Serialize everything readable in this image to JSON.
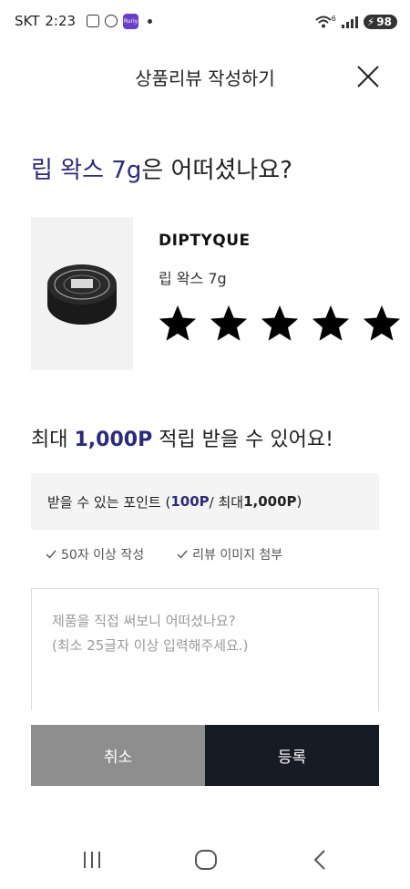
{
  "status_bar": {
    "carrier": "SKT",
    "time": "2:23",
    "app_badge": "Ruriy",
    "battery": "98",
    "wifi_label": "6"
  },
  "header": {
    "title": "상품리뷰 작성하기"
  },
  "question": {
    "product": "립 왁스 7g",
    "suffix": "은 어떠셨나요?"
  },
  "product": {
    "brand": "DIPTYQUE",
    "name": "립 왁스 7g",
    "rating": 5,
    "max_rating": 5
  },
  "points": {
    "title_prefix": "최대 ",
    "title_amount": "1,000P",
    "title_suffix": " 적립 받을 수 있어요!",
    "box_prefix": "받을 수 있는 포인트 (",
    "box_current": "100P",
    "box_middle": " / 최대 ",
    "box_max": "1,000P",
    "box_suffix": ")"
  },
  "conditions": [
    {
      "label": "50자 이상 작성"
    },
    {
      "label": "리뷰 이미지 첨부"
    }
  ],
  "review": {
    "placeholder": "제품을 직접 써보니 어떠셨나요?\n(최소 25글자 이상 입력해주세요.)",
    "value": ""
  },
  "buttons": {
    "cancel": "취소",
    "submit": "등록"
  },
  "colors": {
    "accent": "#2c2a7c",
    "cancel_bg": "#8e8e8e",
    "submit_bg": "#161b24"
  }
}
